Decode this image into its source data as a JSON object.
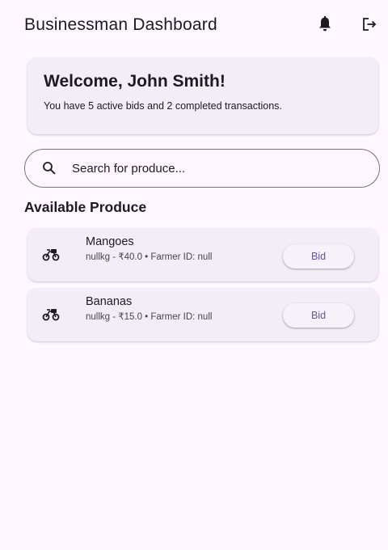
{
  "app_bar": {
    "title": "Businessman Dashboard",
    "notification_icon": "bell-icon",
    "logout_icon": "logout-icon"
  },
  "welcome": {
    "title": "Welcome, John Smith!",
    "subtitle": "You have 5 active bids and 2 completed transactions."
  },
  "search": {
    "placeholder": "Search for produce...",
    "value": "",
    "icon": "search-icon"
  },
  "produce_section": {
    "title": "Available Produce",
    "items": [
      {
        "name": "Mangoes",
        "details": "nullkg - ₹40.0 • Farmer ID: null",
        "icon": "bike-icon",
        "bid_label": "Bid"
      },
      {
        "name": "Bananas",
        "details": "nullkg - ₹15.0 • Farmer ID: null",
        "icon": "bike-icon",
        "bid_label": "Bid"
      }
    ]
  },
  "colors": {
    "background": "#fef7ff",
    "card": "#f3edf7",
    "accent": "#6750a4",
    "text": "#1d1b20"
  }
}
